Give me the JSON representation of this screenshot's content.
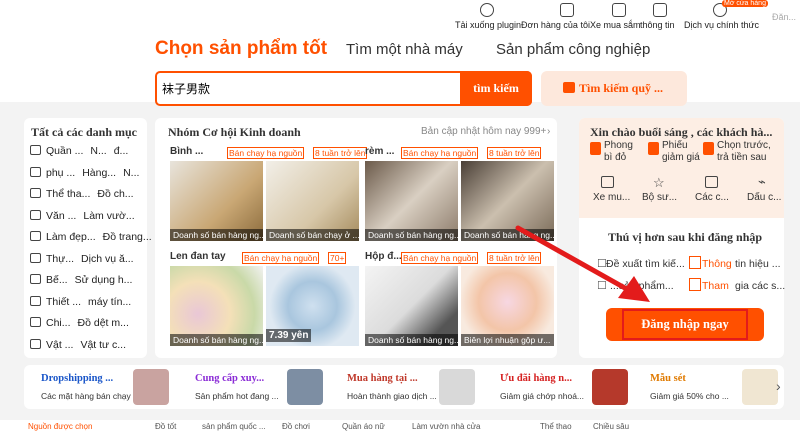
{
  "topnav": {
    "items": [
      "Tải xuống plugin",
      "Đơn hàng của tôi",
      "Xe mua sắm",
      "thông tin",
      "Dịch vụ chính thức"
    ],
    "badge": "Mở cửa hàng",
    "user": "Đăn..."
  },
  "tabs": [
    "Chọn sản phẩm tốt",
    "Tìm một nhà máy",
    "Sản phẩm công nghiệp"
  ],
  "search": {
    "value": "袜子男款",
    "button": "tìm kiếm",
    "image_search": "Tìm kiếm quỹ ..."
  },
  "categories": {
    "title": "Tất cả các danh mục",
    "items": [
      [
        "Quần ...",
        "N...",
        "đ..."
      ],
      [
        "phụ ...",
        "Hàng...",
        "N..."
      ],
      [
        "Thể tha...",
        "Đồ ch..."
      ],
      [
        "Văn ...",
        "Làm vườ..."
      ],
      [
        "Làm đẹp...",
        "Đồ trang..."
      ],
      [
        "Thự...",
        "Dịch vụ ă..."
      ],
      [
        "Bế...",
        "Sử dụng h..."
      ],
      [
        "Thiết ...",
        "máy tín..."
      ],
      [
        "Chi...",
        "Đồ dệt m..."
      ],
      [
        "Vật ...",
        "Vật tư c..."
      ]
    ]
  },
  "opportunity": {
    "title": "Nhóm Cơ hội Kinh doanh",
    "update": "Bản cập nhật hôm nay 999+",
    "products": [
      {
        "title": "Bình ...",
        "badge": "Bán chạy hạ nguồn",
        "badge2": "8 tuần trở lên",
        "caps": [
          "Doanh số bán hàng ng...",
          "Doanh số bán chạy ở ..."
        ]
      },
      {
        "title": "rèm ...",
        "badge": "Bán chạy hạ nguồn",
        "badge2": "8 tuần trở lên",
        "caps": [
          "Doanh số bán hàng ng...",
          "Doanh số bán hàng ng..."
        ]
      },
      {
        "title": "Len đan tay",
        "badge": "Bán chạy hạ nguồn",
        "badge2": "70+",
        "caps": [
          "Doanh số bán hàng ng...",
          "7.39 yên"
        ]
      },
      {
        "title": "Hộp đ...",
        "badge": "Bán chạy hạ nguồn",
        "badge2": "8 tuần trở lên",
        "caps": [
          "Doanh số bán hàng ng...",
          "Biên lợi nhuận gộp ư..."
        ]
      }
    ]
  },
  "user_panel": {
    "greeting": "Xin chào buổi sáng , các khách hà...",
    "perks": [
      "Phong bì đỏ",
      "Phiếu giảm giá",
      "Chọn trước, trả tiền sau"
    ],
    "icons": [
      "Xe mu...",
      "Bộ sư...",
      "Các c...",
      "Dấu c..."
    ],
    "subtitle": "Thú vị hơn sau khi đăng nhập",
    "lines": [
      [
        "Đề xuất tìm kiế...",
        "Thông",
        "tin hiệu ..."
      ],
      [
        "...sản phẩm...",
        "Tham",
        "gia các s..."
      ]
    ],
    "login": "Đăng nhập ngay"
  },
  "bottom": [
    {
      "title": "Dropshipping ...",
      "sub": "Các mặt hàng bán chạy ...",
      "color": "#1a56c9"
    },
    {
      "title": "Cung cấp xuy...",
      "sub": "Sản phẩm hot đang ...",
      "color": "#8a2bd6"
    },
    {
      "title": "Mua hàng tại ...",
      "sub": "Hoàn thành giao dịch ...",
      "color": "#c0392b"
    },
    {
      "title": "Ưu đãi hàng n...",
      "sub": "Giảm giá chớp nhoá...",
      "color": "#d62222"
    },
    {
      "title": "Mẫu sét",
      "sub": "Giảm giá 50% cho ...",
      "color": "#e07a00"
    }
  ],
  "footer": [
    "Nguồn được chọn",
    "Đồ tốt",
    "sản phẩm quốc ...",
    "Đồ chơi",
    "Quần áo nữ",
    "Làm vườn nhà cửa",
    "Thể thao",
    "Chiều sâu"
  ],
  "colors": {
    "accent": "#ff5000",
    "highlight": "#e31b1b"
  }
}
